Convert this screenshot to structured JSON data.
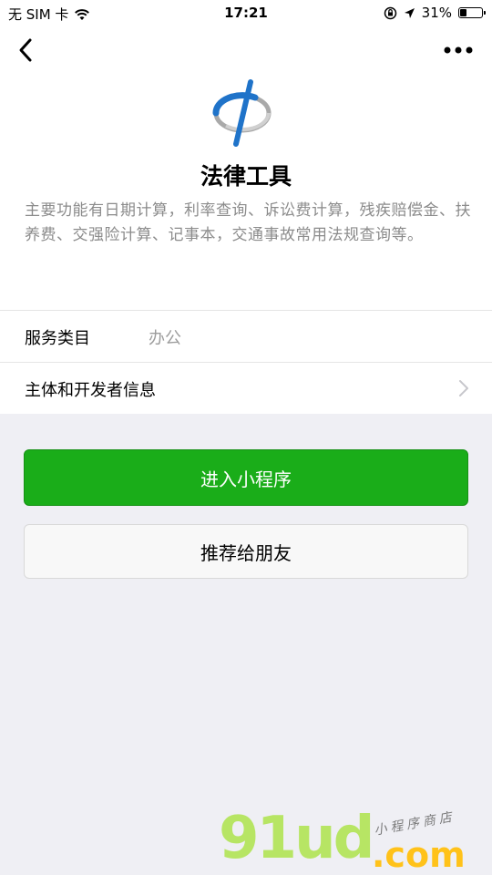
{
  "status_bar": {
    "carrier": "无 SIM 卡",
    "time": "17:21",
    "battery": "31%",
    "battery_level": 0.31
  },
  "app": {
    "name": "法律工具",
    "description": "主要功能有日期计算，利率查询、诉讼费计算，残疾赔偿金、扶养费、交强险计算、记事本，交通事故常用法规查询等。"
  },
  "info_rows": [
    {
      "label": "服务类目",
      "value": "办公"
    },
    {
      "label": "主体和开发者信息",
      "value": ""
    }
  ],
  "buttons": {
    "enter": "进入小程序",
    "share": "推荐给朋友"
  },
  "watermark": {
    "brand": "91ud",
    "suffix": ".com",
    "tagline": "小程序商店"
  },
  "colors": {
    "primary_green": "#1aad19",
    "page_background": "#efeff4",
    "watermark_green": "#b7e564",
    "watermark_orange": "#ffc21a"
  }
}
